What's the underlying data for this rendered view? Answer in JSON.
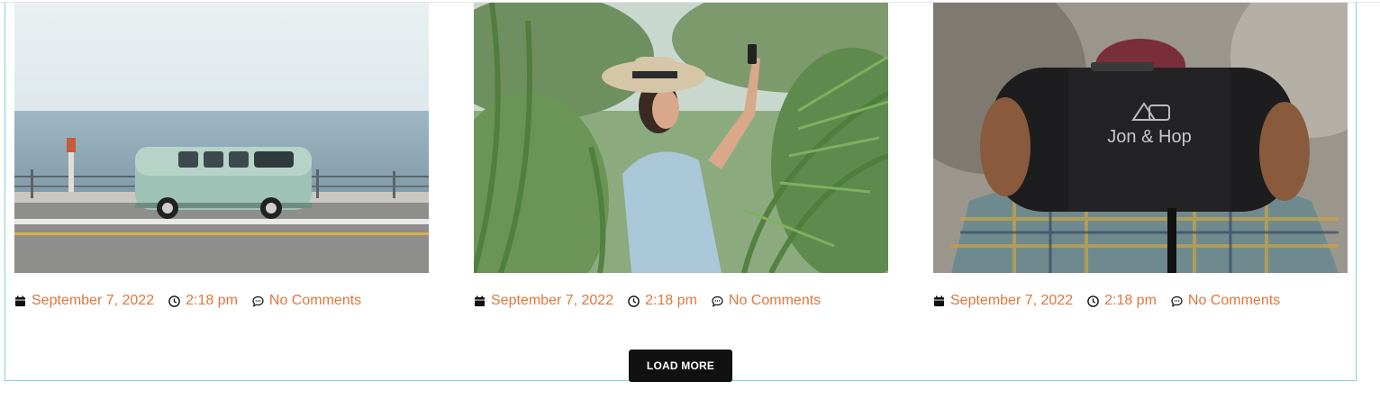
{
  "posts": [
    {
      "image_alt": "Vintage van driving along seaside road",
      "date": "September 7, 2022",
      "time": "2:18 pm",
      "comments": "No Comments"
    },
    {
      "image_alt": "Woman in sun hat taking photo among palm leaves",
      "date": "September 7, 2022",
      "time": "2:18 pm",
      "comments": "No Comments"
    },
    {
      "image_alt": "Person holding Jon & Hop sleeping bag",
      "date": "September 7, 2022",
      "time": "2:18 pm",
      "comments": "No Comments",
      "product_logo_text": "Jon & Hop"
    }
  ],
  "load_more_label": "LOAD MORE",
  "colors": {
    "meta_text": "#e0763c",
    "frame_border": "#7fd3da",
    "button_bg": "#111111"
  },
  "icons": {
    "date": "calendar-icon",
    "time": "clock-icon",
    "comments": "comment-icon"
  }
}
